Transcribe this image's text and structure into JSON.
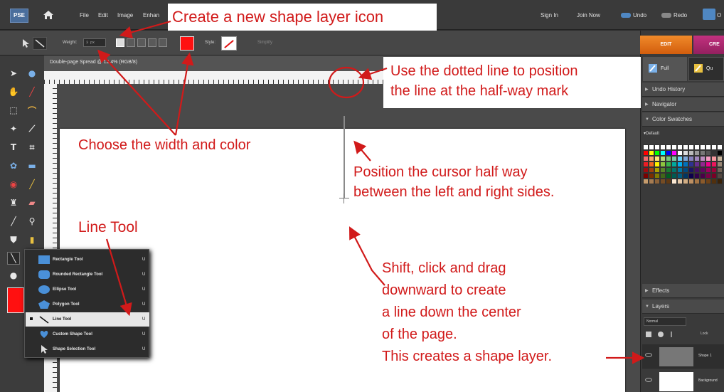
{
  "menubar": {
    "logo": "PSE",
    "menus": [
      "File",
      "Edit",
      "Image",
      "Enhan"
    ],
    "sign_in": "Sign In",
    "join_now": "Join Now",
    "undo": "Undo",
    "redo": "Redo",
    "organizer_partial": "O"
  },
  "options": {
    "weight_label": "Weight:",
    "weight_value": "3 px",
    "style_label": "Style:",
    "simplify": "Simplify",
    "color": "#ff1010"
  },
  "document": {
    "title": "Double-page Spread @ 12.4% (RGB/8)"
  },
  "right_panel": {
    "edit_tab": "EDIT",
    "create_tab": "CRE",
    "mode_full": "Full",
    "mode_quick": "Qu",
    "panels": [
      "Undo History",
      "Navigator",
      "Color Swatches"
    ],
    "swatch_set": "Default",
    "bottom_panels": [
      "Effects",
      "Layers"
    ],
    "blend_mode": "Normal",
    "lock_label": "Lock",
    "layers": [
      {
        "name": "Shape 1"
      },
      {
        "name": "Background"
      }
    ]
  },
  "flyout": {
    "items": [
      {
        "label": "Rectangle Tool",
        "key": "U",
        "icon": "rectangle-icon"
      },
      {
        "label": "Rounded Rectangle Tool",
        "key": "U",
        "icon": "rounded-rectangle-icon"
      },
      {
        "label": "Ellipse Tool",
        "key": "U",
        "icon": "ellipse-icon"
      },
      {
        "label": "Polygon Tool",
        "key": "U",
        "icon": "polygon-icon"
      },
      {
        "label": "Line Tool",
        "key": "U",
        "icon": "line-icon",
        "selected": true
      },
      {
        "label": "Custom Shape Tool",
        "key": "U",
        "icon": "custom-shape-icon"
      },
      {
        "label": "Shape Selection Tool",
        "key": "U",
        "icon": "shape-selection-icon"
      }
    ]
  },
  "annotations": {
    "create_layer": "Create a new shape layer icon",
    "dotted_line_1": "Use the dotted line to position",
    "dotted_line_2": "the line at the half-way mark",
    "width_color": "Choose the width and color",
    "cursor_1": "Position the cursor half way",
    "cursor_2": "between the left and right sides.",
    "line_tool": "Line Tool",
    "shift_1": "Shift, click and drag",
    "shift_2": "downward to create",
    "shift_3": "a line down the center",
    "shift_4": "of the page.",
    "shift_5": "This creates a shape layer.",
    "color": "#d11a1a"
  }
}
